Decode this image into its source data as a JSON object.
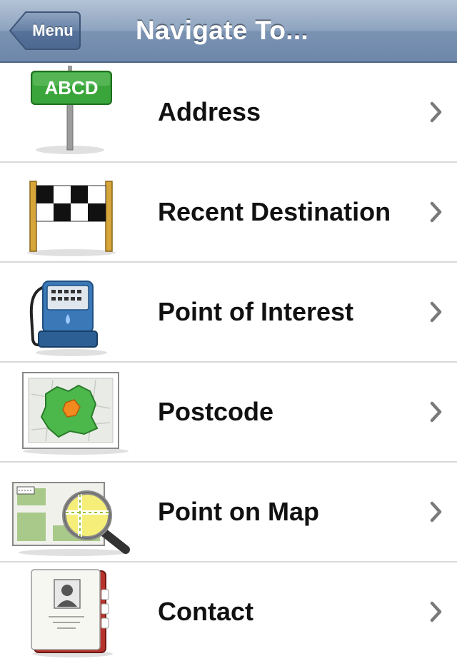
{
  "navbar": {
    "back_label": "Menu",
    "title": "Navigate To..."
  },
  "items": [
    {
      "label": "Address",
      "icon": "address-sign-icon",
      "sign_text": "ABCD"
    },
    {
      "label": "Recent Destination",
      "icon": "checkered-flag-icon"
    },
    {
      "label": "Point of Interest",
      "icon": "fuel-pump-icon"
    },
    {
      "label": "Postcode",
      "icon": "postcode-map-icon"
    },
    {
      "label": "Point on Map",
      "icon": "magnifier-map-icon"
    },
    {
      "label": "Contact",
      "icon": "address-book-icon"
    }
  ],
  "colors": {
    "navbar_top": "#b4c3d6",
    "navbar_bottom": "#6d87a9",
    "sign_green": "#3aa53a",
    "chevron": "#7a7a7a"
  }
}
